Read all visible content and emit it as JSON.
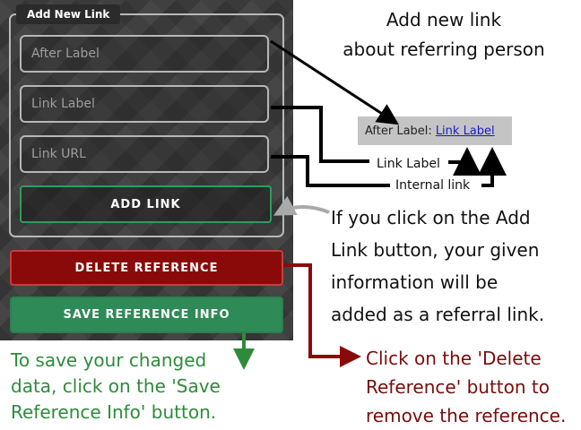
{
  "form": {
    "legend": "Add New Link",
    "after_label_placeholder": "After Label",
    "link_label_placeholder": "Link Label",
    "link_url_placeholder": "Link URL",
    "add_link_button": "ADD LINK",
    "delete_button": "DELETE REFERENCE",
    "save_button": "SAVE REFERENCE INFO"
  },
  "preview": {
    "after_label": "After Label:",
    "link_label": "Link Label"
  },
  "annotations": {
    "title_line1": "Add new link",
    "title_line2": "about referring person",
    "link_label_tag": "Link Label",
    "internal_link_tag": "Internal link",
    "add_note_line1": "If you click on the Add",
    "add_note_line2": "Link button, your given",
    "add_note_line3": "information will be",
    "add_note_line4": "added as a referral link.",
    "save_note_line1": "To save your changed",
    "save_note_line2": "data, click on the 'Save",
    "save_note_line3": "Reference Info' button.",
    "delete_note_line1": "Click on the 'Delete",
    "delete_note_line2": "Reference' button to",
    "delete_note_line3": "remove the reference."
  },
  "colors": {
    "add_border": "#2f9c5d",
    "delete_fill": "#8a0a0a",
    "save_fill": "#2e8b57",
    "save_note_text": "#2e8b3c",
    "delete_note_text": "#7a0c0c",
    "link_blue": "#1a1acc"
  }
}
